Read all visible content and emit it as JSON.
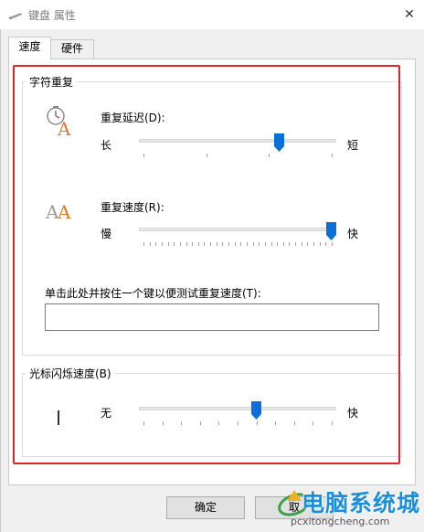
{
  "window": {
    "title": "键盘 属性",
    "close_glyph": "✕"
  },
  "tabs": [
    {
      "label": "速度",
      "selected": true
    },
    {
      "label": "硬件",
      "selected": false
    }
  ],
  "repeat_group": {
    "title": "字符重复",
    "delay": {
      "label": "重复延迟(D):",
      "min_label": "长",
      "max_label": "短",
      "value": 0.72,
      "ticks": 4,
      "icon": "clock-a-icon"
    },
    "rate": {
      "label": "重复速度(R):",
      "min_label": "慢",
      "max_label": "快",
      "value": 1.0,
      "ticks": 32,
      "icon": "double-a-icon"
    },
    "test": {
      "label": "单击此处并按住一个键以便测试重复速度(T):",
      "value": ""
    }
  },
  "cursor_group": {
    "title": "光标闪烁速度(B)",
    "min_label": "无",
    "max_label": "快",
    "value": 0.6,
    "ticks": 11
  },
  "buttons": {
    "ok": "确定",
    "cancel": "取"
  },
  "watermark": {
    "text": "电脑系统城",
    "url": "pcxitongcheng.com"
  },
  "colors": {
    "highlight": "#e0252a",
    "thumb": "#0a6fd6",
    "watermark": "#1a8fe0"
  }
}
